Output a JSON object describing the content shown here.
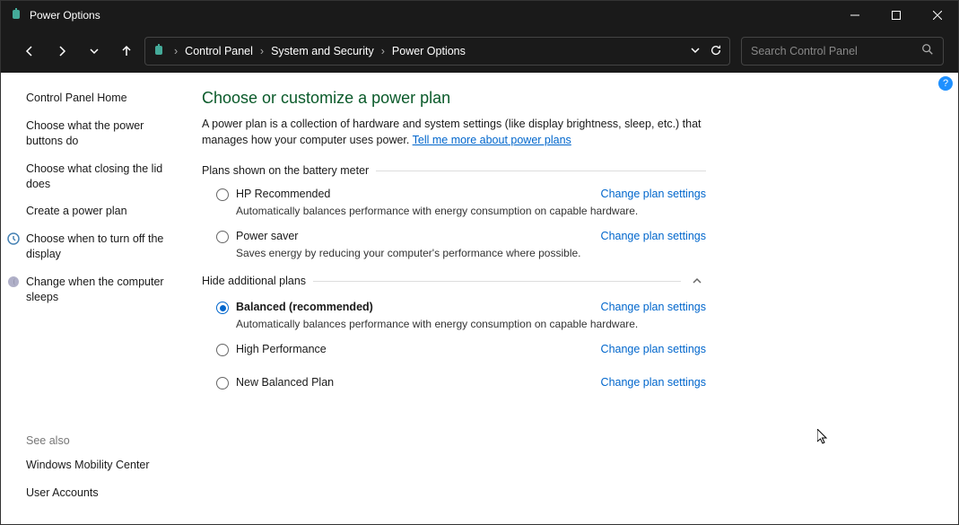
{
  "window": {
    "title": "Power Options"
  },
  "breadcrumbs": {
    "items": [
      "Control Panel",
      "System and Security",
      "Power Options"
    ]
  },
  "search": {
    "placeholder": "Search Control Panel"
  },
  "sidebar": {
    "home": "Control Panel Home",
    "links": [
      {
        "label": "Choose what the power buttons do",
        "icon": null
      },
      {
        "label": "Choose what closing the lid does",
        "icon": null
      },
      {
        "label": "Create a power plan",
        "icon": null
      },
      {
        "label": "Choose when to turn off the display",
        "icon": "clock"
      },
      {
        "label": "Change when the computer sleeps",
        "icon": "moon"
      }
    ],
    "see_also_header": "See also",
    "see_also": [
      {
        "label": "Windows Mobility Center"
      },
      {
        "label": "User Accounts"
      }
    ]
  },
  "main": {
    "title": "Choose or customize a power plan",
    "desc_prefix": "A power plan is a collection of hardware and system settings (like display brightness, sleep, etc.) that manages how your computer uses power. ",
    "desc_link": "Tell me more about power plans",
    "section1_header": "Plans shown on the battery meter",
    "section2_header": "Hide additional plans",
    "change_link": "Change plan settings",
    "plans_battery": [
      {
        "name": "HP Recommended",
        "selected": false,
        "desc": "Automatically balances performance with energy consumption on capable hardware."
      },
      {
        "name": "Power saver",
        "selected": false,
        "desc": "Saves energy by reducing your computer's performance where possible."
      }
    ],
    "plans_additional": [
      {
        "name": "Balanced (recommended)",
        "selected": true,
        "bold": true,
        "desc": "Automatically balances performance with energy consumption on capable hardware."
      },
      {
        "name": "High Performance",
        "selected": false,
        "desc": null
      },
      {
        "name": "New Balanced Plan",
        "selected": false,
        "desc": null
      }
    ]
  }
}
